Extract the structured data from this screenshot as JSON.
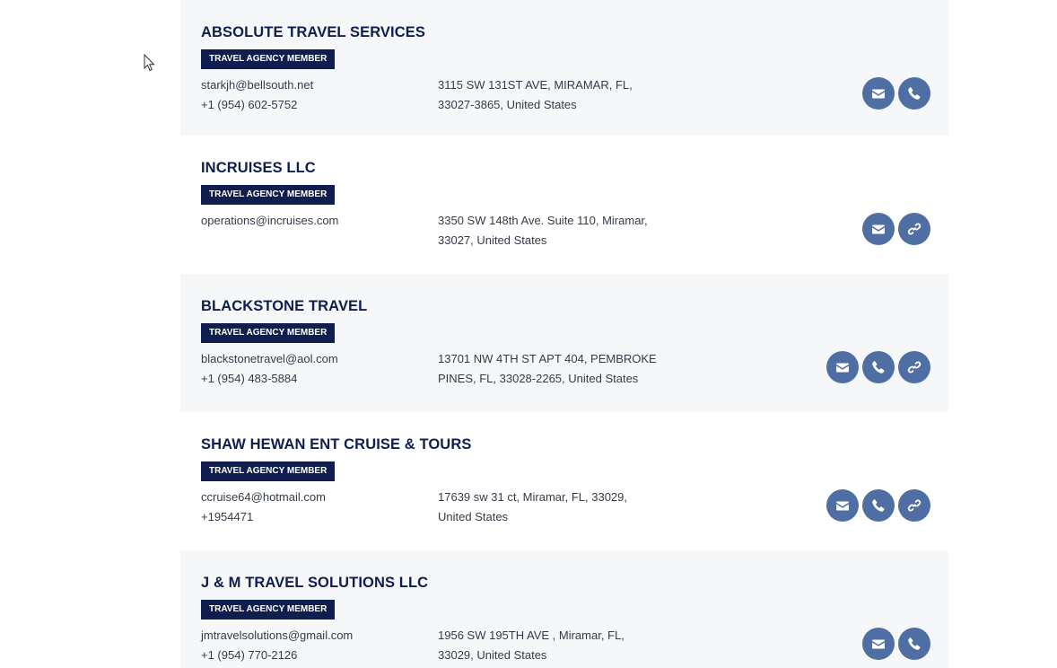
{
  "listings": [
    {
      "name": "ABSOLUTE TRAVEL SERVICES",
      "badge": "TRAVEL AGENCY MEMBER",
      "email": "starkjh@bellsouth.net",
      "phone": "+1 (954) 602-5752",
      "address_line1": "3115 SW 131ST AVE, MIRAMAR, FL,",
      "address_line2": "33027-3865, United States",
      "actions": [
        "email",
        "phone"
      ]
    },
    {
      "name": "INCRUISES LLC",
      "badge": "TRAVEL AGENCY MEMBER",
      "email": "operations@incruises.com",
      "phone": "",
      "address_line1": "3350 SW 148th Ave. Suite 110, Miramar,",
      "address_line2": "33027, United States",
      "actions": [
        "email",
        "link"
      ]
    },
    {
      "name": "BLACKSTONE TRAVEL",
      "badge": "TRAVEL AGENCY MEMBER",
      "email": "blackstonetravel@aol.com",
      "phone": "+1 (954) 483-5884",
      "address_line1": "13701 NW 4TH ST APT 404, PEMBROKE",
      "address_line2": "PINES, FL, 33028-2265, United States",
      "actions": [
        "email",
        "phone",
        "link"
      ]
    },
    {
      "name": "SHAW HEWAN ENT CRUISE & TOURS",
      "badge": "TRAVEL AGENCY MEMBER",
      "email": "ccruise64@hotmail.com",
      "phone": "+1954471",
      "address_line1": "17639 sw 31 ct, Miramar, FL, 33029,",
      "address_line2": "United States",
      "actions": [
        "email",
        "phone",
        "link"
      ]
    },
    {
      "name": "J & M TRAVEL SOLUTIONS LLC",
      "badge": "TRAVEL AGENCY MEMBER",
      "email": "jmtravelsolutions@gmail.com",
      "phone": "+1 (954) 770-2126",
      "address_line1": "1956 SW 195TH AVE , Miramar, FL,",
      "address_line2": "33029, United States",
      "actions": [
        "email",
        "phone"
      ]
    }
  ],
  "colors": {
    "title": "#0f1e4f",
    "badge_bg": "#0f1e4f",
    "button_bg": "#4f6fa4",
    "shaded_row": "#f6f7f9"
  }
}
